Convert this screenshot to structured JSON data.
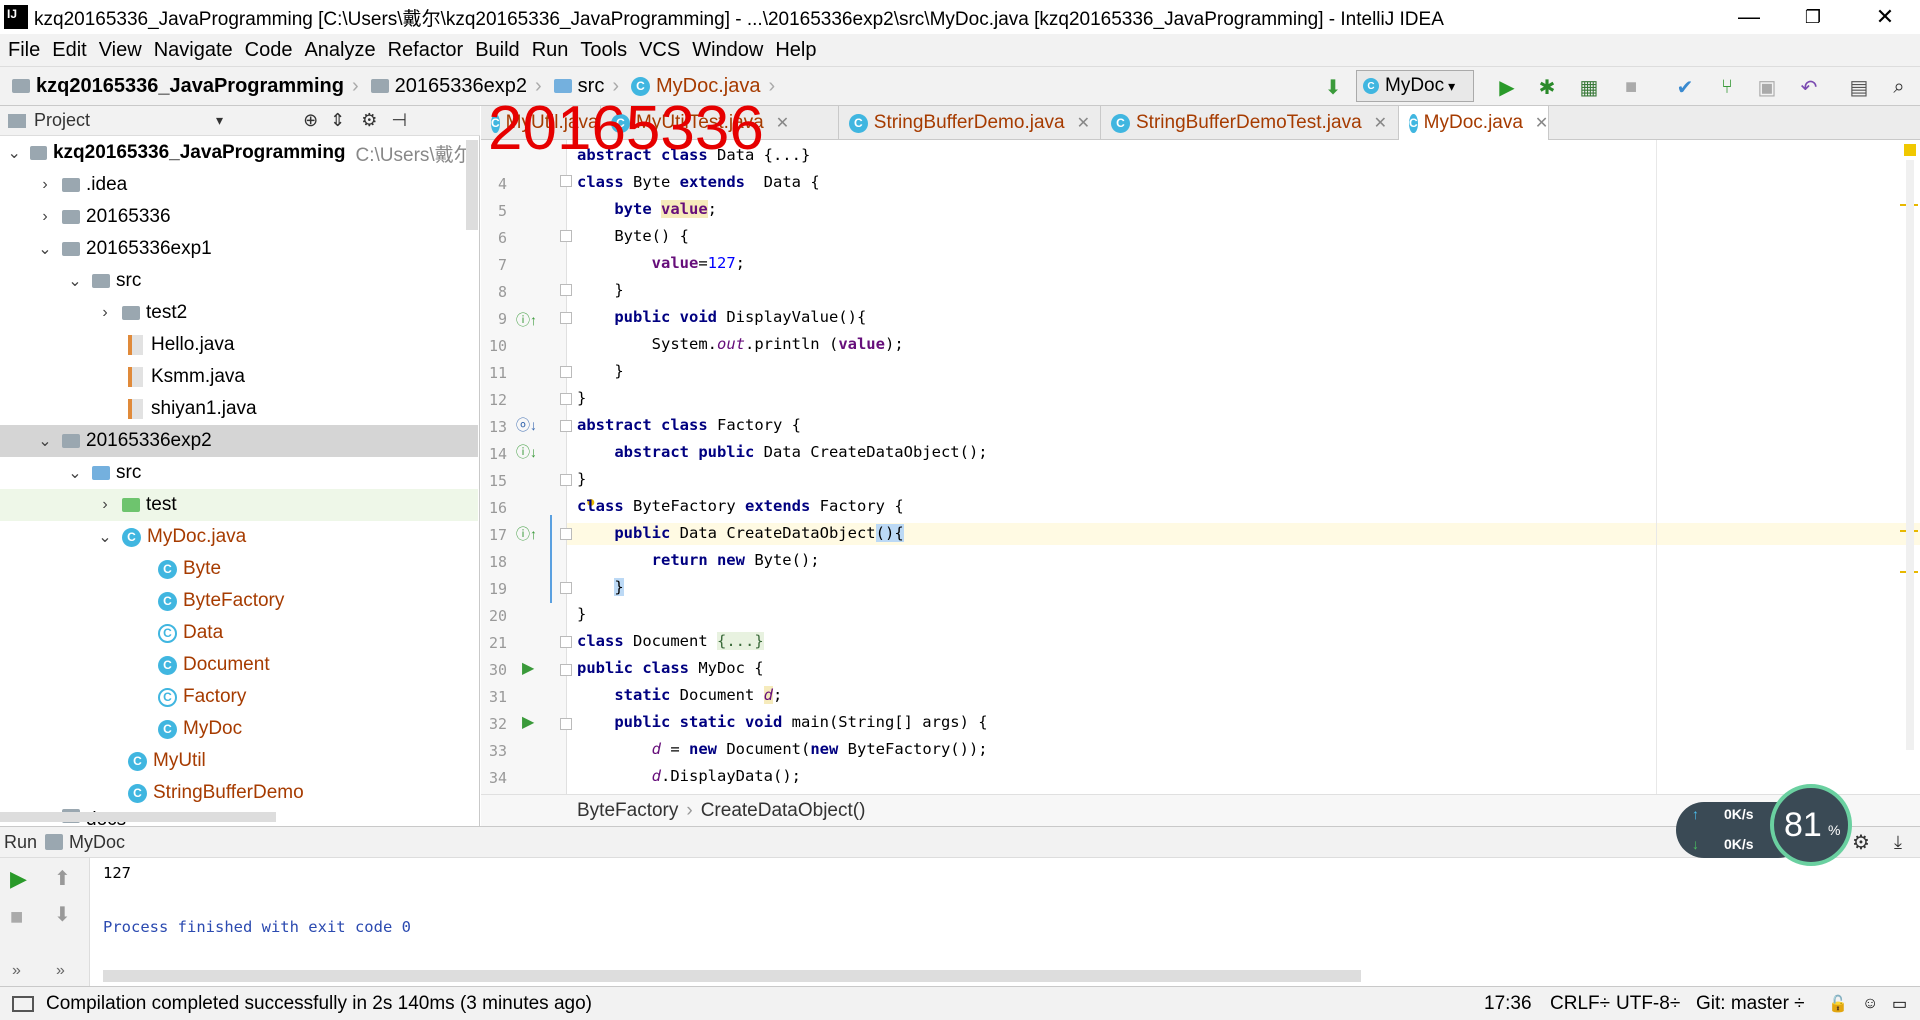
{
  "window": {
    "title": "kzq20165336_JavaProgramming [C:\\Users\\戴尔\\kzq20165336_JavaProgramming] - ...\\20165336exp2\\src\\MyDoc.java [kzq20165336_JavaProgramming] - IntelliJ IDEA",
    "minimize": "—",
    "restore": "❐",
    "close": "✕"
  },
  "menu": [
    "File",
    "Edit",
    "View",
    "Navigate",
    "Code",
    "Analyze",
    "Refactor",
    "Build",
    "Run",
    "Tools",
    "VCS",
    "Window",
    "Help"
  ],
  "breadcrumbs": [
    "kzq20165336_JavaProgramming",
    "20165336exp2",
    "src",
    "MyDoc.java"
  ],
  "run_config": "MyDoc",
  "project_panel": {
    "title": "Project",
    "tree": [
      {
        "label": "kzq20165336_JavaProgramming",
        "extra": "C:\\Users\\戴尔\\"
      },
      {
        "label": ".idea"
      },
      {
        "label": "20165336"
      },
      {
        "label": "20165336exp1"
      },
      {
        "label": "src"
      },
      {
        "label": "test2"
      },
      {
        "label": "Hello.java"
      },
      {
        "label": "Ksmm.java"
      },
      {
        "label": "shiyan1.java"
      },
      {
        "label": "20165336exp2"
      },
      {
        "label": "src"
      },
      {
        "label": "test"
      },
      {
        "label": "MyDoc.java"
      },
      {
        "label": "Byte"
      },
      {
        "label": "ByteFactory"
      },
      {
        "label": "Data"
      },
      {
        "label": "Document"
      },
      {
        "label": "Factory"
      },
      {
        "label": "MyDoc"
      },
      {
        "label": "MyUtil"
      },
      {
        "label": "StringBufferDemo"
      },
      {
        "label": "docs"
      }
    ]
  },
  "tabs": [
    "MyUtil.java",
    "MyUtilTest.java",
    "StringBufferDemo.java",
    "StringBufferDemoTest.java",
    "MyDoc.java"
  ],
  "watermark": "20165336",
  "line_numbers": [
    "4",
    "5",
    "6",
    "7",
    "8",
    "9",
    "10",
    "11",
    "12",
    "13",
    "14",
    "15",
    "16",
    "17",
    "18",
    "19",
    "20",
    "21",
    "30",
    "31",
    "32",
    "33",
    "34"
  ],
  "editor_breadcrumb": [
    "ByteFactory",
    "CreateDataObject()"
  ],
  "run_panel": {
    "label": "Run",
    "config": "MyDoc",
    "output": [
      "127",
      "",
      "Process finished with exit code 0"
    ]
  },
  "net_widget": {
    "up": "0K/s",
    "down": "0K/s",
    "percent": "81",
    "percent_unit": "%"
  },
  "status": {
    "message": "Compilation completed successfully in 2s 140ms (3 minutes ago)",
    "position": "17:36",
    "line_sep": "CRLF÷",
    "encoding": "UTF-8÷",
    "git": "Git: master ÷"
  },
  "colors": {
    "accent": "#40b6e0",
    "watermark": "#e60000",
    "selection": "#d5d5d5",
    "current_line": "#fffae3"
  }
}
